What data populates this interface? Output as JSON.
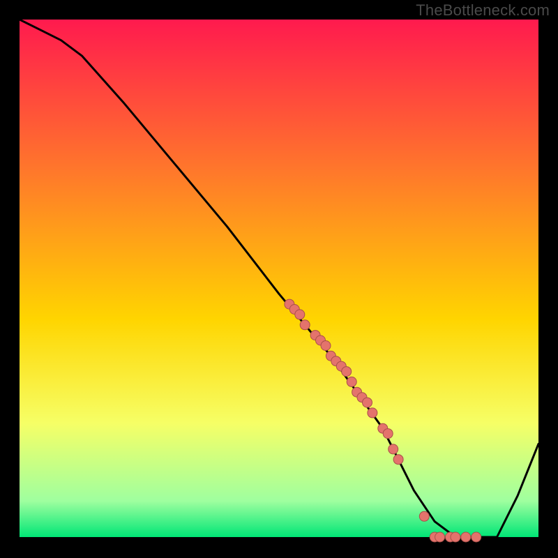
{
  "watermark": "TheBottleneck.com",
  "chart_data": {
    "type": "line",
    "title": "",
    "xlabel": "",
    "ylabel": "",
    "xlim": [
      0,
      100
    ],
    "ylim": [
      0,
      100
    ],
    "grid": false,
    "legend": false,
    "background_gradient": {
      "top": "#ff1a4e",
      "upper_mid": "#ff7a2a",
      "mid": "#ffd500",
      "lower_mid": "#f6ff66",
      "near_bottom": "#9fff9f",
      "bottom": "#00e676"
    },
    "series": [
      {
        "name": "curve",
        "color": "#000000",
        "x": [
          0,
          4,
          8,
          12,
          20,
          30,
          40,
          50,
          55,
          60,
          65,
          70,
          73,
          76,
          80,
          84,
          88,
          92,
          96,
          100
        ],
        "y": [
          100,
          98,
          96,
          93,
          84,
          72,
          60,
          47,
          41,
          35,
          28,
          21,
          15,
          9,
          3,
          0,
          0,
          0,
          8,
          18
        ]
      }
    ],
    "markers": {
      "name": "data-points",
      "color": "#e4736c",
      "outline": "#a94f49",
      "radius_px": 7,
      "x": [
        52,
        53,
        54,
        55,
        57,
        58,
        59,
        60,
        61,
        62,
        63,
        64,
        65,
        66,
        67,
        68,
        70,
        71,
        72,
        73,
        78,
        80,
        81,
        83,
        84,
        86,
        88
      ],
      "y": [
        45,
        44,
        43,
        41,
        39,
        38,
        37,
        35,
        34,
        33,
        32,
        30,
        28,
        27,
        26,
        24,
        21,
        20,
        17,
        15,
        4,
        0,
        0,
        0,
        0,
        0,
        0
      ]
    }
  }
}
